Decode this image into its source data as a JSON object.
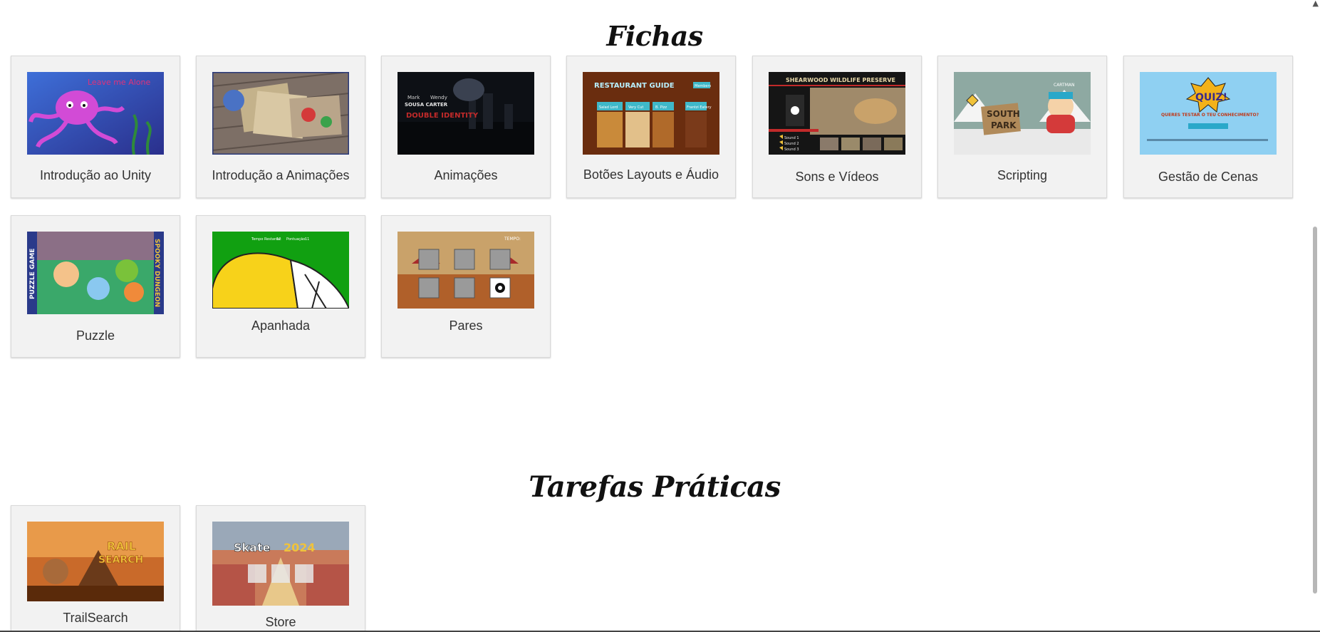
{
  "sections": {
    "fichas": {
      "title": "Fichas"
    },
    "tarefas": {
      "title": "Tarefas Práticas"
    }
  },
  "fichas": [
    {
      "label": "Introdução ao Unity",
      "thumb_text": "Leave me Alone"
    },
    {
      "label": "Introdução a Animações"
    },
    {
      "label": "Animações",
      "thumb_text_1": "Mark",
      "thumb_text_2": "Wendy",
      "thumb_text_3": "SOUSA  CARTER",
      "thumb_text_4": "DOUBLE IDENTITY"
    },
    {
      "label": "Botões Layouts e Áudio",
      "thumb_title": "RESTAURANT GUIDE",
      "thumb_text_1": "Salad Lord",
      "thumb_text_2": "Very Cut",
      "thumb_text_3": "B. Pizz",
      "thumb_text_4": "Frantzi Eatery",
      "thumb_button": "Members"
    },
    {
      "label": "Sons e Vídeos",
      "thumb_title": "SHEARWOOD WILDLIFE PRESERVE",
      "thumb_text_1": "Sound 1",
      "thumb_text_2": "Sound 2",
      "thumb_text_3": "Sound 3"
    },
    {
      "label": "Scripting",
      "thumb_title": "CARTMAN",
      "thumb_text_1": "SOUTH",
      "thumb_text_2": "PARK"
    },
    {
      "label": "Gestão de Cenas",
      "thumb_title": "QUIZ!",
      "thumb_text_1": "QUERES TESTAR O TEU CONHECIMENTO?"
    },
    {
      "label": "Puzzle",
      "thumb_text_1": "PUZZLE GAME",
      "thumb_text_2": "SPOOKY DUNGEON"
    },
    {
      "label": "Apanhada",
      "thumb_text_1": "Tempo Restante:",
      "thumb_text_2": "12",
      "thumb_text_3": "Pontuação:",
      "thumb_text_4": "11"
    },
    {
      "label": "Pares",
      "thumb_text_1": "TEMPO:"
    }
  ],
  "tarefas": [
    {
      "label": "TrailSearch",
      "thumb_text_1": "RAIL",
      "thumb_text_2": "SEARCH"
    },
    {
      "label": "Store",
      "thumb_text_1": "Skate",
      "thumb_text_2": "2024"
    }
  ],
  "colors": {
    "card_bg": "#f2f2f2",
    "card_border": "#d9d9d9",
    "title": "#111111",
    "label": "#333333"
  }
}
